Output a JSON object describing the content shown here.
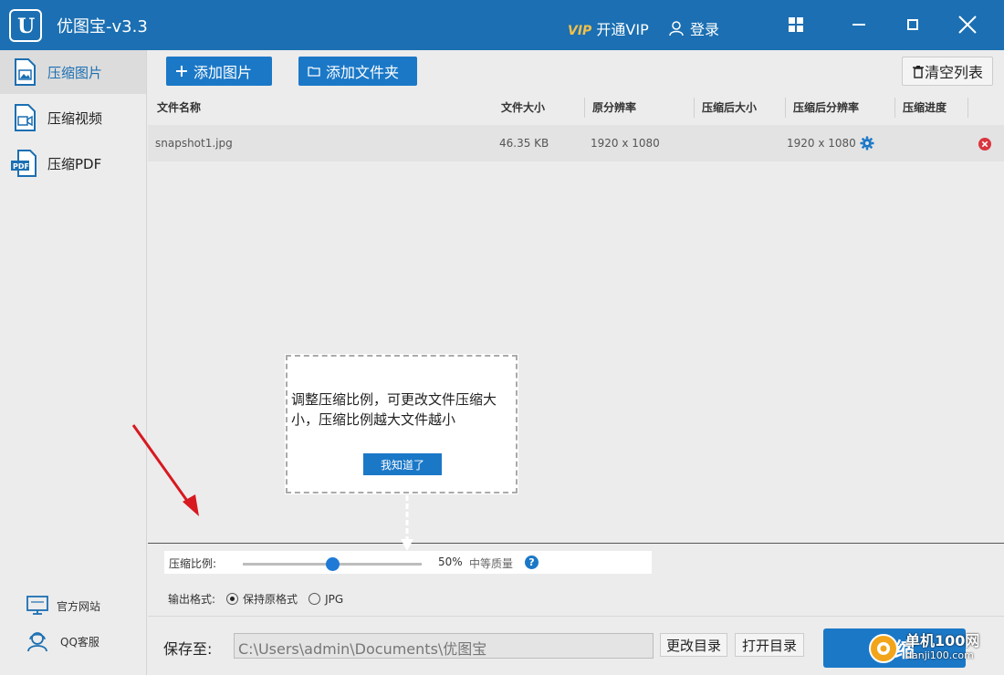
{
  "app": {
    "title": "优图宝-v3.3",
    "vip_word": "VIP",
    "vip_text": "开通VIP",
    "login": "登录"
  },
  "sidebar": {
    "items": [
      {
        "label": "压缩图片",
        "icon": "image-file-icon"
      },
      {
        "label": "压缩视频",
        "icon": "video-file-icon"
      },
      {
        "label": "压缩PDF",
        "icon": "pdf-file-icon"
      }
    ],
    "official_site": "官方网站",
    "qq_service": "QQ客服"
  },
  "toolbar": {
    "add_image": "添加图片",
    "add_folder": "添加文件夹",
    "clear_list": "清空列表"
  },
  "table": {
    "headers": [
      "文件名称",
      "文件大小",
      "原分辨率",
      "压缩后大小",
      "压缩后分辨率",
      "压缩进度"
    ],
    "rows": [
      {
        "name": "snapshot1.jpg",
        "size": "46.35 KB",
        "orig_res": "1920 x 1080",
        "new_size": "",
        "new_res": "1920 x 1080",
        "progress": ""
      }
    ]
  },
  "ratio": {
    "label": "压缩比例:",
    "value": "50%",
    "value_fraction": 0.5,
    "quality": "中等质量",
    "help": "?"
  },
  "format": {
    "label": "输出格式:",
    "options": [
      "保持原格式",
      "JPG"
    ],
    "selected": "保持原格式"
  },
  "save": {
    "label": "保存至:",
    "path": "C:\\Users\\admin\\Documents\\优图宝",
    "change_dir": "更改目录",
    "open_dir": "打开目录",
    "compress": "压缩"
  },
  "popup": {
    "text": "调整压缩比例，可更改文件压缩大小，压缩比例越大文件越小",
    "button": "我知道了"
  },
  "watermark": {
    "name": "单机100网",
    "url": "danji100.com"
  },
  "colors": {
    "brand_blue": "#1b6fb2",
    "button_blue": "#1b78c7",
    "vip_gold": "#f2c04a",
    "delete_red": "#d9363e",
    "arrow_red": "#d71920"
  }
}
